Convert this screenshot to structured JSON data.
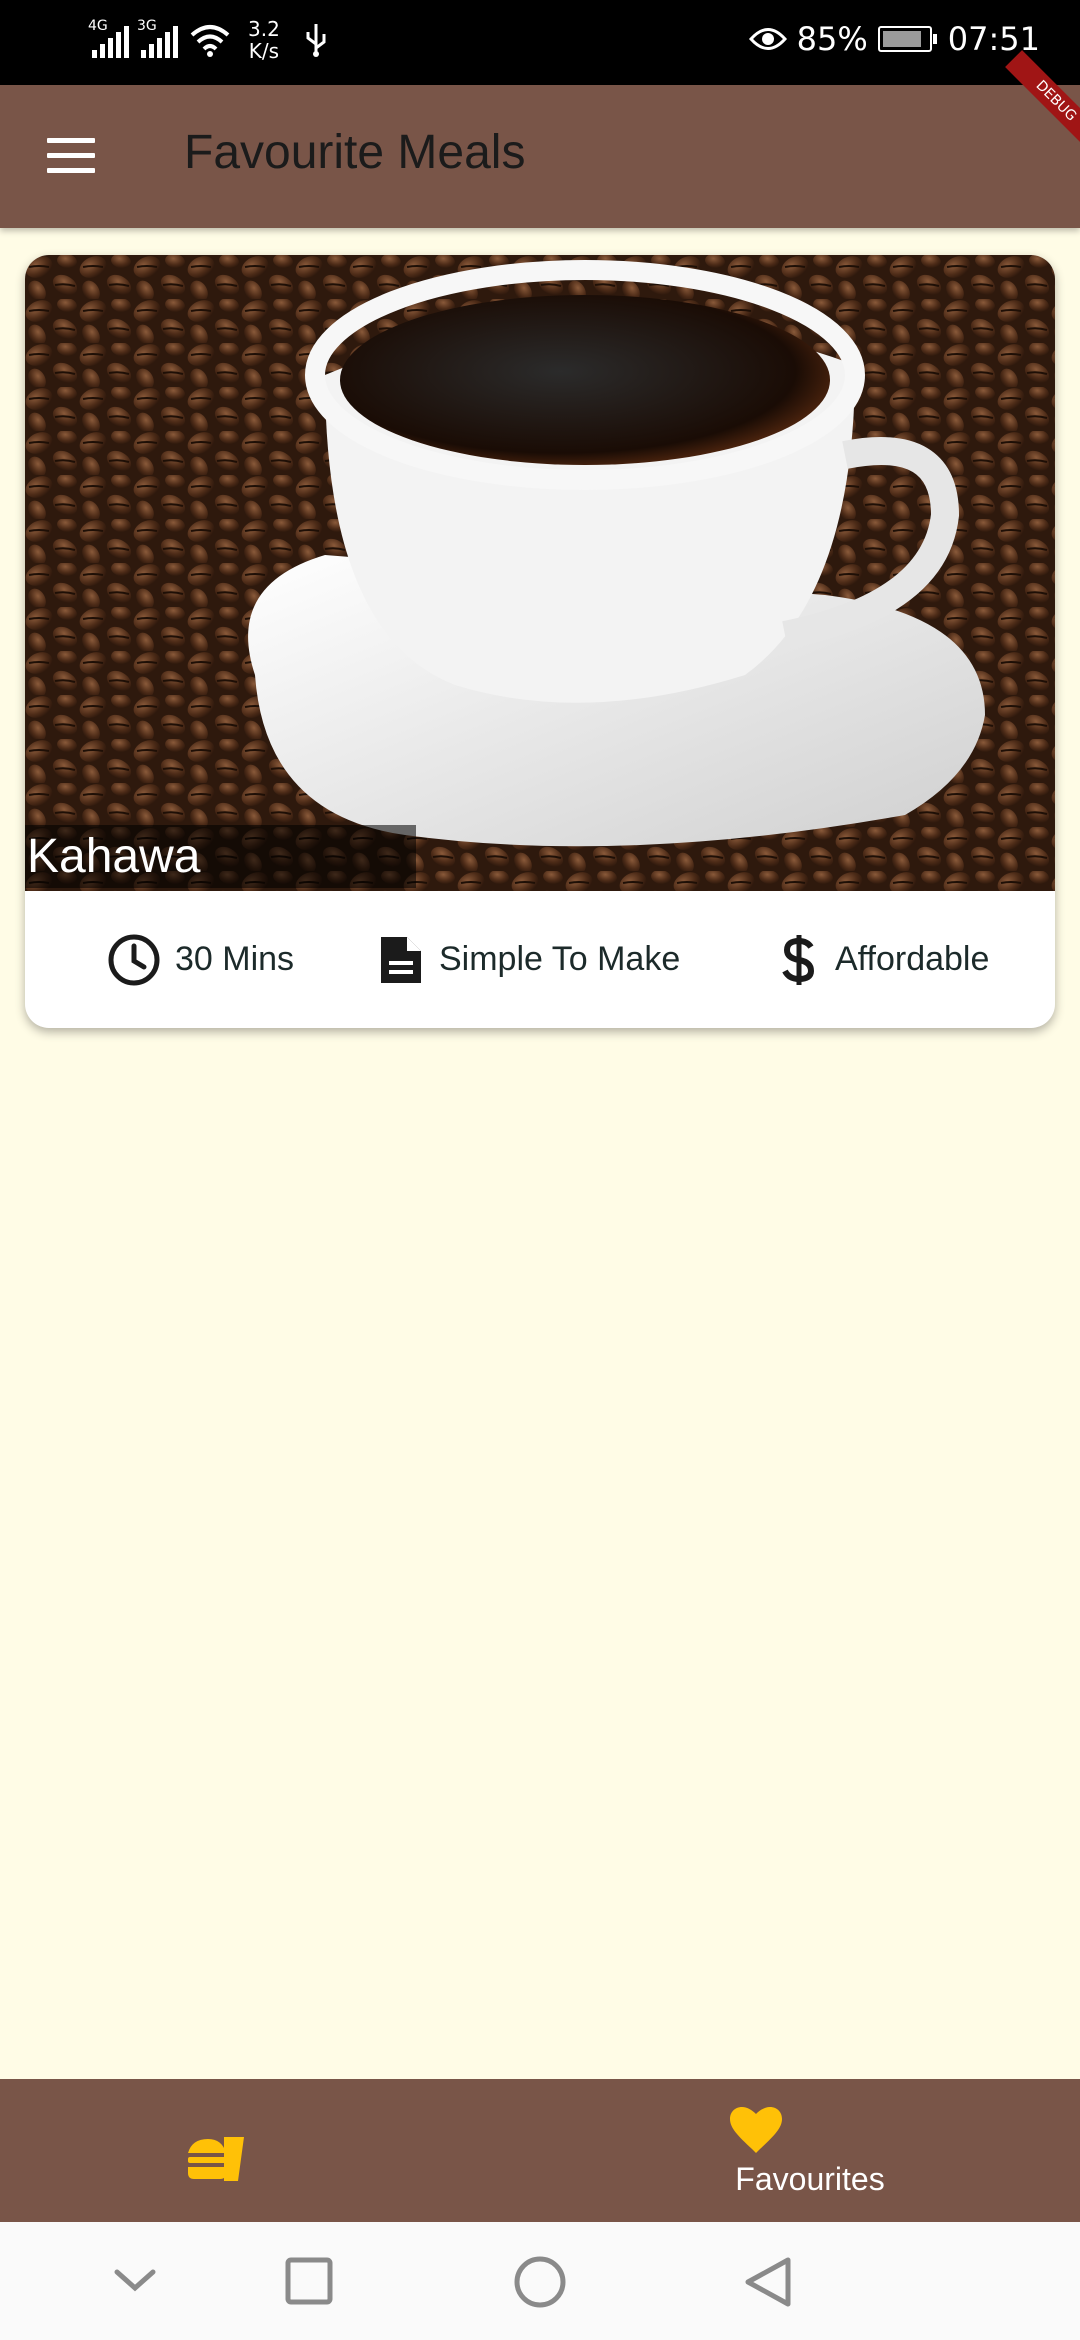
{
  "status_bar": {
    "signal1_tag": "4G",
    "signal2_tag": "3G",
    "net_speed_value": "3.2",
    "net_speed_unit": "K/s",
    "battery": "85%",
    "time": "07:51"
  },
  "app_bar": {
    "title": "Favourite Meals",
    "debug_banner": "DEBUG"
  },
  "meals": [
    {
      "title": "Kahawa",
      "duration": "30 Mins",
      "complexity": "Simple To Make",
      "affordability": "Affordable",
      "image": "coffee-cup-on-beans"
    }
  ],
  "bottom_nav": {
    "items": [
      {
        "label": "",
        "icon": "fastfood-icon",
        "selected": false
      },
      {
        "label": "Favourites",
        "icon": "heart-icon",
        "selected": true
      }
    ],
    "accent": "#FFC107",
    "background": "#795548"
  },
  "colors": {
    "primary": "#795548",
    "canvas": "#FFFCE6",
    "accent": "#FFC107"
  },
  "system_nav": [
    "chevron-down-icon",
    "recents-icon",
    "home-icon",
    "back-icon"
  ]
}
